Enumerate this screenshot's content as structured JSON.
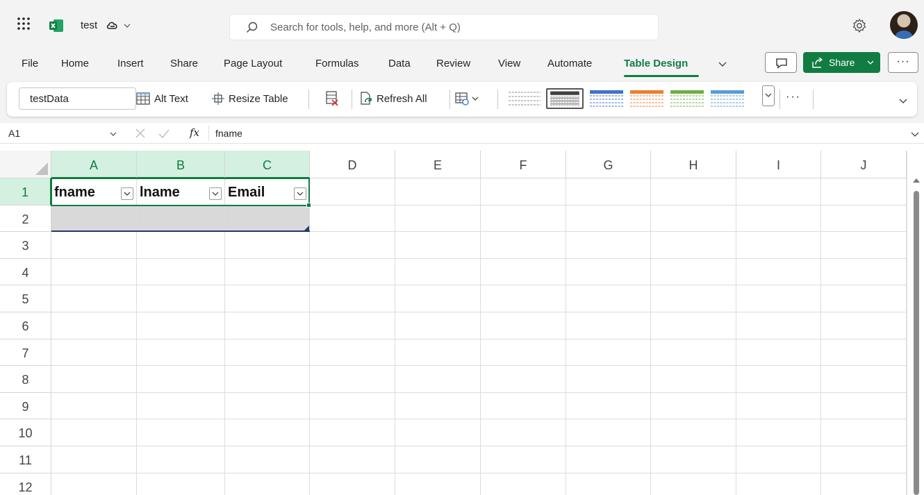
{
  "title_bar": {
    "app_launcher_icon": "waffle-grid-icon",
    "app_icon": "excel-logo-icon",
    "doc_title": "test",
    "cloud_icon": "cloud-sync-icon",
    "search_placeholder": "Search for tools, help, and more (Alt + Q)",
    "settings_icon": "gear-icon",
    "avatar": "user-avatar"
  },
  "menu_tabs": [
    "File",
    "Home",
    "Insert",
    "Share",
    "Page Layout",
    "Formulas",
    "Data",
    "Review",
    "View",
    "Automate",
    "Table Design"
  ],
  "active_tab": "Table Design",
  "share_button": {
    "label": "Share"
  },
  "more_label": "···",
  "ribbon": {
    "table_name": "testData",
    "alt_text_label": "Alt Text",
    "resize_table_label": "Resize Table",
    "refresh_all_label": "Refresh All",
    "more_label": "···",
    "table_styles": [
      {
        "name": "None",
        "color": "#ffffff"
      },
      {
        "name": "Dark Gray",
        "color": "#404040"
      },
      {
        "name": "Blue",
        "color": "#4472c4"
      },
      {
        "name": "Orange",
        "color": "#ed7d31"
      },
      {
        "name": "Green",
        "color": "#70ad47"
      },
      {
        "name": "Light Blue",
        "color": "#5b9bd5"
      }
    ],
    "selected_style": "Dark Gray"
  },
  "formula_bar": {
    "name_box": "A1",
    "fx": "fx",
    "content": "fname"
  },
  "grid": {
    "columns": [
      "A",
      "B",
      "C",
      "D",
      "E",
      "F",
      "G",
      "H",
      "I",
      "J"
    ],
    "rows": [
      "1",
      "2",
      "3",
      "4",
      "5",
      "6",
      "7",
      "8",
      "9",
      "10",
      "11",
      "12"
    ],
    "table_headers": [
      "fname",
      "lname",
      "Email"
    ],
    "active_cell": "A1"
  },
  "colors": {
    "accent": "#107c41",
    "selection_fill": "#d3f0e0",
    "empty_row_fill": "#d9d9d9"
  }
}
